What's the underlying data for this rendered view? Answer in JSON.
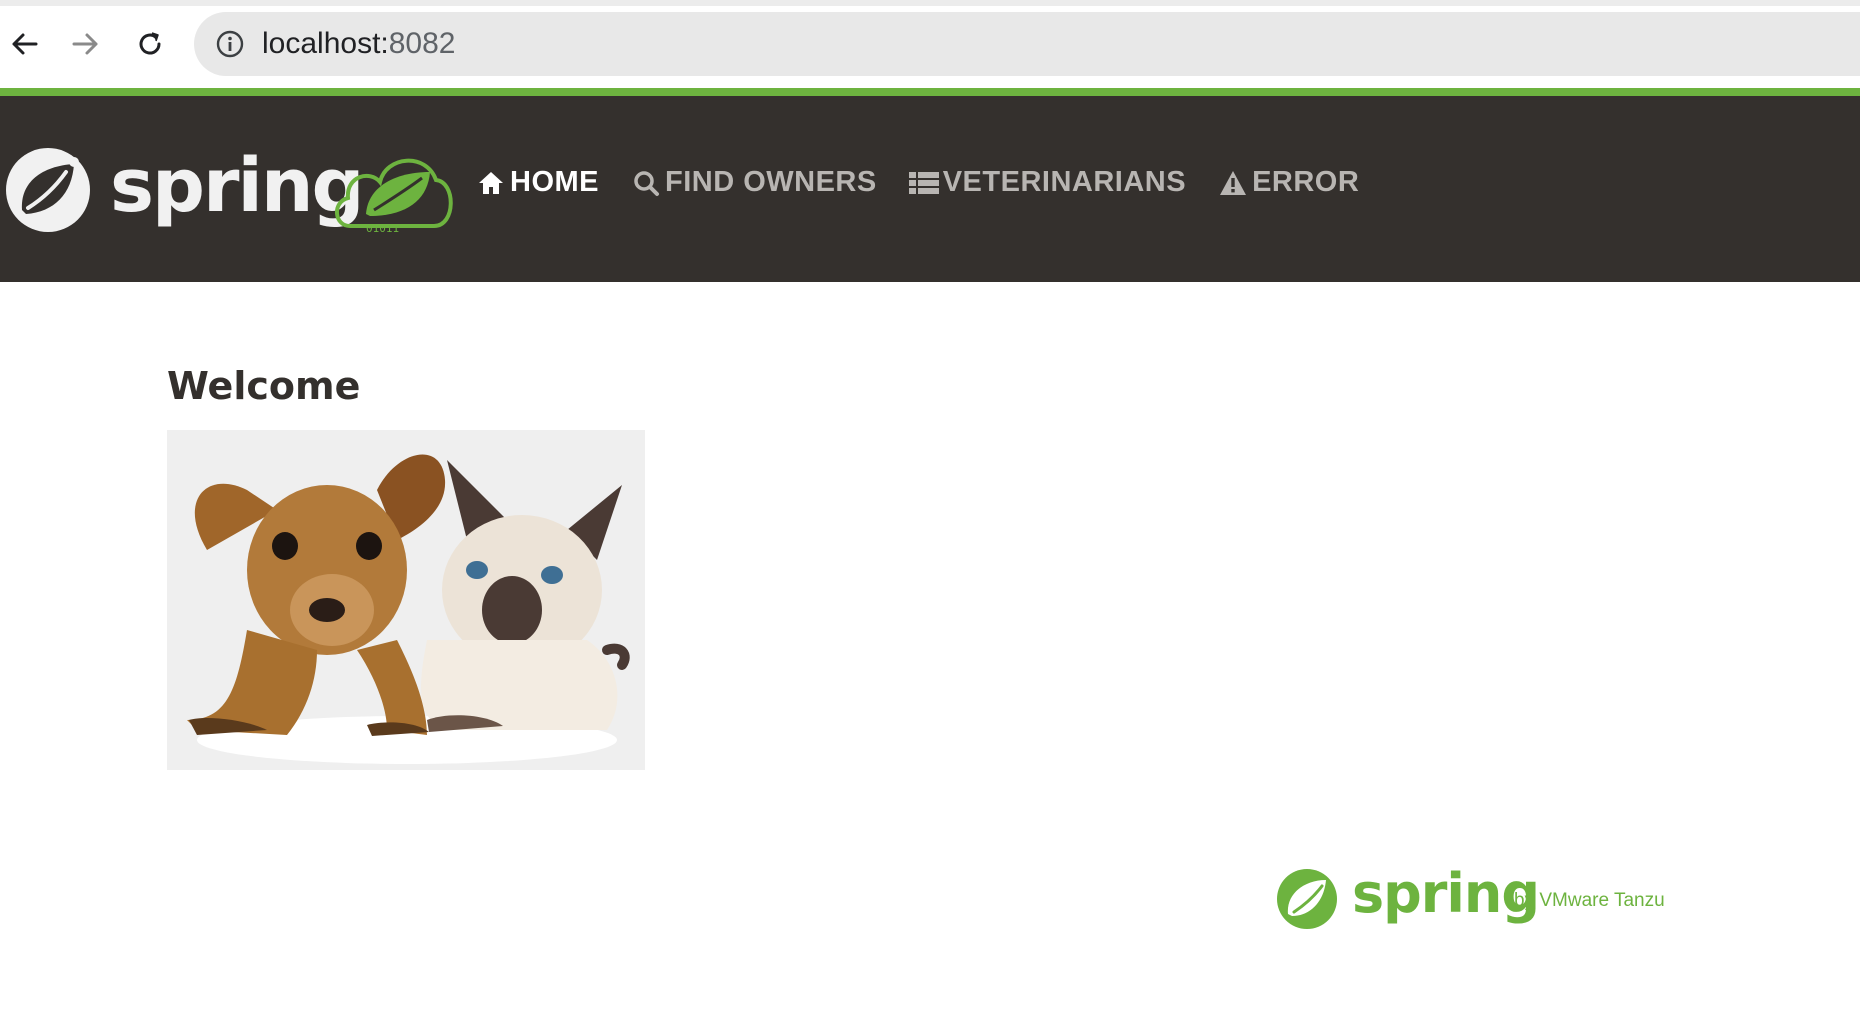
{
  "browser": {
    "url_host": "localhost:",
    "url_port": "8082"
  },
  "navbar": {
    "brand_text": "spring",
    "brand_binary": "01011",
    "items": [
      {
        "label": "HOME",
        "icon": "home-icon",
        "active": true
      },
      {
        "label": "FIND OWNERS",
        "icon": "search-icon",
        "active": false
      },
      {
        "label": "VETERINARIANS",
        "icon": "list-icon",
        "active": false
      },
      {
        "label": "ERROR",
        "icon": "warning-icon",
        "active": false
      }
    ]
  },
  "main": {
    "heading": "Welcome"
  },
  "footer": {
    "brand_text": "spring",
    "byline": "by VMware Tanzu"
  },
  "colors": {
    "accent": "#6db33f",
    "navbar_bg": "#34302d",
    "nav_inactive": "#b8b5b2"
  }
}
